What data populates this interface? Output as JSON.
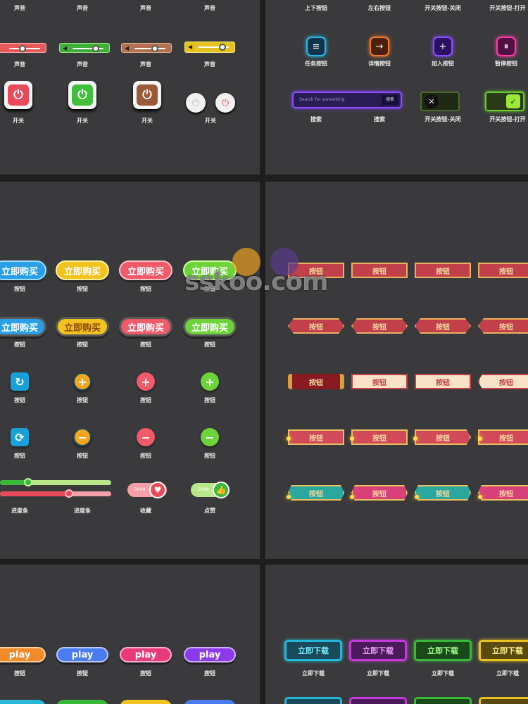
{
  "panel1": {
    "top_labels": [
      "声音",
      "声音",
      "声音",
      "声音"
    ],
    "sliders": [
      {
        "color": "#e85a5a",
        "knob": 0.5
      },
      {
        "color": "#3fae3a",
        "knob": 0.65
      },
      {
        "color": "#b07252",
        "knob": 0.6
      },
      {
        "color": "#e6c21e",
        "knob": 0.55
      }
    ],
    "slider_labels": [
      "声音",
      "声音",
      "声音",
      "声音"
    ],
    "power_labels": [
      "开关",
      "开关",
      "开关",
      "开关"
    ],
    "power_glyph": "⏻"
  },
  "panel2": {
    "top_labels": [
      "上下按钮",
      "左右按钮",
      "开关按钮-关闭",
      "开关按钮-打开"
    ],
    "icons": [
      {
        "name": "menu-icon",
        "glyph": "≡",
        "color": "#2bb6e8"
      },
      {
        "name": "arrow-right-icon",
        "glyph": "→",
        "color": "#f07a2a"
      },
      {
        "name": "plus-icon",
        "glyph": "+",
        "color": "#8a4dff"
      },
      {
        "name": "pause-icon",
        "glyph": "⏸",
        "color": "#ff3aa8"
      }
    ],
    "icon_labels": [
      "任务按钮",
      "详情按钮",
      "加入按钮",
      "暂停按钮"
    ],
    "search_placeholder": "Search for something",
    "search_button": "搜索",
    "search_labels": [
      "搜索",
      "搜索"
    ],
    "toggle_labels": [
      "开关按钮-关闭",
      "开关按钮-打开"
    ],
    "toggle_off_glyph": "✕",
    "toggle_on_glyph": "✓"
  },
  "panel3": {
    "buy_text": "立即购买",
    "buy_colors": [
      "#2a9fe8",
      "#f2c31e",
      "#f05a6a",
      "#6cd43a"
    ],
    "buy_labels": [
      "按钮",
      "按钮",
      "按钮",
      "按钮"
    ],
    "buy_labels2": [
      "按钮",
      "按钮",
      "按钮",
      "按钮"
    ],
    "plus_labels": [
      "按钮",
      "按钮",
      "按钮",
      "按钮"
    ],
    "minus_labels": [
      "按钮",
      "按钮",
      "按钮",
      "按钮"
    ],
    "bottom_labels": [
      "进度条",
      "进度条",
      "收藏",
      "点赞"
    ],
    "fav_count": "2048",
    "like_count": "2048",
    "progress": [
      0.3,
      0.6
    ]
  },
  "panel4": {
    "btn_text": "按钮"
  },
  "panel5": {
    "play_text": "play",
    "play_colors": [
      "#f28a2a",
      "#4a7cf0",
      "#e83a7a",
      "#8a3ae8"
    ],
    "labels": [
      "按钮",
      "按钮",
      "按钮",
      "按钮"
    ]
  },
  "panel6": {
    "dl_text": "立即下载",
    "dl_colors": [
      "#23b8d8",
      "#c23ad8",
      "#3ab83a",
      "#e8c21e"
    ],
    "labels": [
      "立即下载",
      "立即下载",
      "立即下载",
      "立即下载"
    ]
  },
  "watermark": "sskoo.com"
}
